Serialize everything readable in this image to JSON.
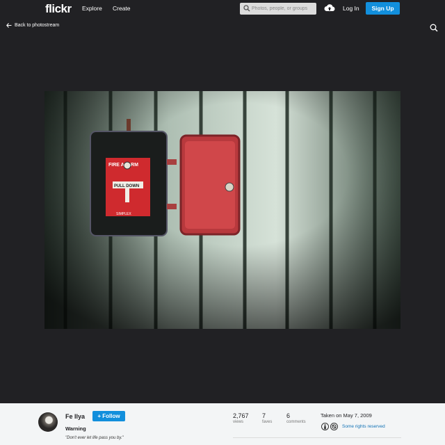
{
  "header": {
    "logo": "flickr",
    "nav": {
      "explore": "Explore",
      "create": "Create"
    },
    "search_placeholder": "Photos, people, or groups",
    "login": "Log In",
    "signup": "Sign Up"
  },
  "stage": {
    "back_label": "Back to photostream"
  },
  "photo": {
    "owner": "Fe Ilya",
    "follow_label": "+ Follow",
    "title": "Warning",
    "description": "\"Don't ever let life pass you by.\"",
    "sign_text_top": "FIRE ALARM",
    "sign_text_pull": "PULL DOWN",
    "brand": "SIMPLEX"
  },
  "stats": {
    "views": {
      "value": "2,767",
      "label": "views"
    },
    "faves": {
      "value": "7",
      "label": "faves"
    },
    "comments": {
      "value": "6",
      "label": "comments"
    }
  },
  "taken": "Taken on May 7, 2009",
  "license": "Some rights reserved",
  "colors": {
    "accent": "#128fdc",
    "bg_dark": "#212124",
    "link": "#1272b5"
  }
}
